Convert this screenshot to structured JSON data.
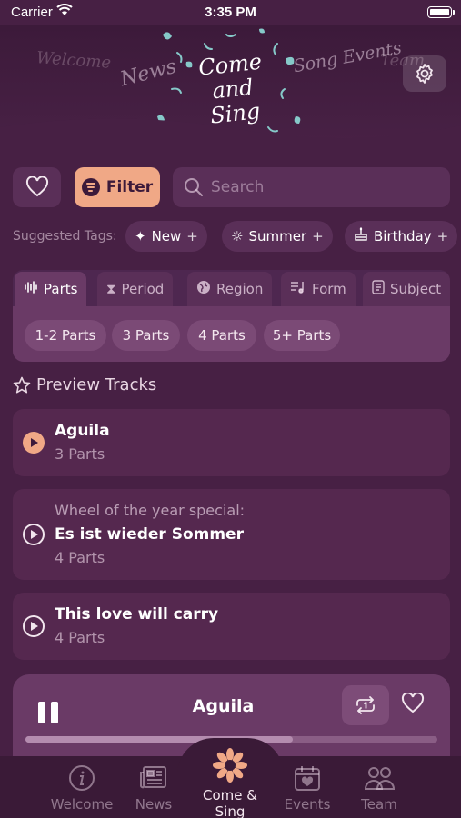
{
  "status_bar": {
    "carrier": "Carrier",
    "time": "3:35 PM"
  },
  "header": {
    "nav_words": [
      "Welcome",
      "News",
      "Song Events",
      "Team"
    ],
    "logo_lines": [
      "Come",
      "and",
      "Sing"
    ]
  },
  "toolbar": {
    "filter_label": "Filter",
    "search_placeholder": "Search"
  },
  "suggested_tags": {
    "label": "Suggested Tags:",
    "items": [
      {
        "label": "New",
        "icon": "sparkles-icon"
      },
      {
        "label": "Summer",
        "icon": "sun-icon"
      },
      {
        "label": "Birthday",
        "icon": "cake-icon"
      }
    ]
  },
  "category_tabs": [
    {
      "label": "Parts",
      "icon": "waveform-icon",
      "active": true
    },
    {
      "label": "Period",
      "icon": "hourglass-icon",
      "active": false
    },
    {
      "label": "Region",
      "icon": "globe-icon",
      "active": false
    },
    {
      "label": "Form",
      "icon": "music-list-icon",
      "active": false
    },
    {
      "label": "Subject",
      "icon": "document-icon",
      "active": false
    }
  ],
  "part_options": [
    "1-2 Parts",
    "3 Parts",
    "4 Parts",
    "5+ Parts"
  ],
  "preview_section": {
    "title": "Preview Tracks"
  },
  "tracks": [
    {
      "subtitle": "",
      "title": "Aguila",
      "parts": "3 Parts",
      "playing": true
    },
    {
      "subtitle": "Wheel of the year special:",
      "title": "Es ist wieder Sommer",
      "parts": "4 Parts",
      "playing": false
    },
    {
      "subtitle": "",
      "title": "This love will carry",
      "parts": "4 Parts",
      "playing": false
    }
  ],
  "player": {
    "title": "Aguila",
    "progress": 0.65
  },
  "tabbar": {
    "items": [
      {
        "label": "Welcome",
        "icon": "info-icon"
      },
      {
        "label": "News",
        "icon": "newspaper-icon"
      },
      {
        "label": "Come & Sing",
        "icon": "flower-icon"
      },
      {
        "label": "Events",
        "icon": "calendar-heart-icon"
      },
      {
        "label": "Team",
        "icon": "people-icon"
      }
    ]
  },
  "colors": {
    "background": "#472044",
    "accent": "#f0a886",
    "card": "#55284f"
  }
}
